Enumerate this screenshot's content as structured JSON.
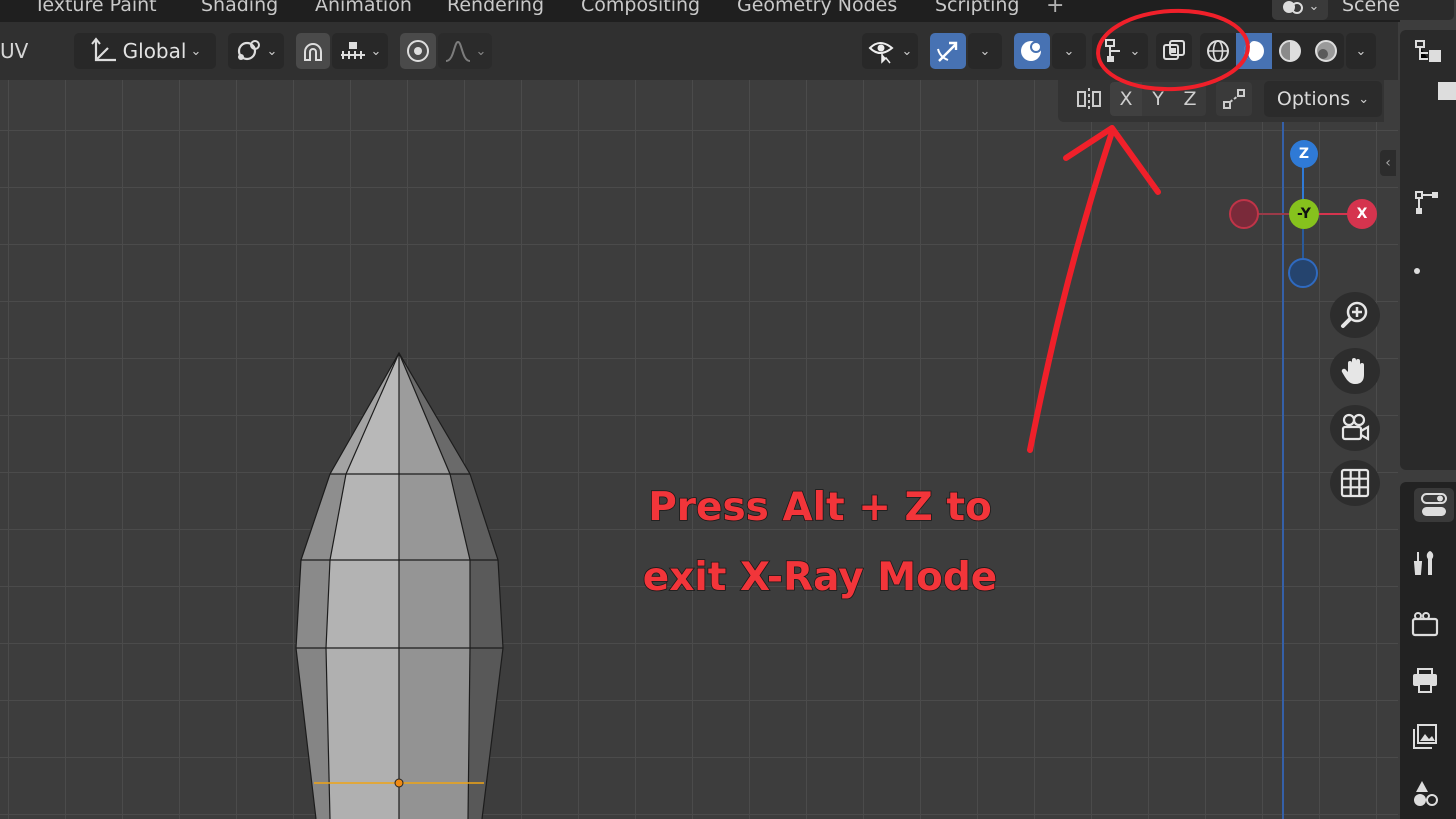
{
  "workspace_tabs": [
    "Texture Paint",
    "Shading",
    "Animation",
    "Rendering",
    "Compositing",
    "Geometry Nodes",
    "Scripting"
  ],
  "scene_label": "Scene",
  "toolbar": {
    "editor_mode": "UV",
    "transform_orientation": "Global"
  },
  "overlay_header": {
    "axis_x": "X",
    "axis_y": "Y",
    "axis_z": "Z",
    "options_label": "Options"
  },
  "gizmo": {
    "z_label": "Z",
    "y_label": "-Y",
    "x_label": "X",
    "colors": {
      "z": "#2f7ad6",
      "y": "#86c21d",
      "x": "#d5344e"
    }
  },
  "annotation": {
    "line1": "Press Alt + Z to",
    "line2": "exit X-Ray Mode",
    "color": "#f2353a"
  },
  "icons": [
    "transform-orientation-icon",
    "pivot-icon",
    "snap-icon",
    "proportional-edit-icon",
    "visibility-icon",
    "gizmo-icon",
    "overlay-icon",
    "mesh-edit-overlay-icon",
    "xray-toggle-icon",
    "wireframe-shading-icon",
    "solid-shading-icon",
    "material-shading-icon",
    "rendered-shading-icon",
    "zoom-icon",
    "pan-hand-icon",
    "camera-icon",
    "grid-icon"
  ]
}
